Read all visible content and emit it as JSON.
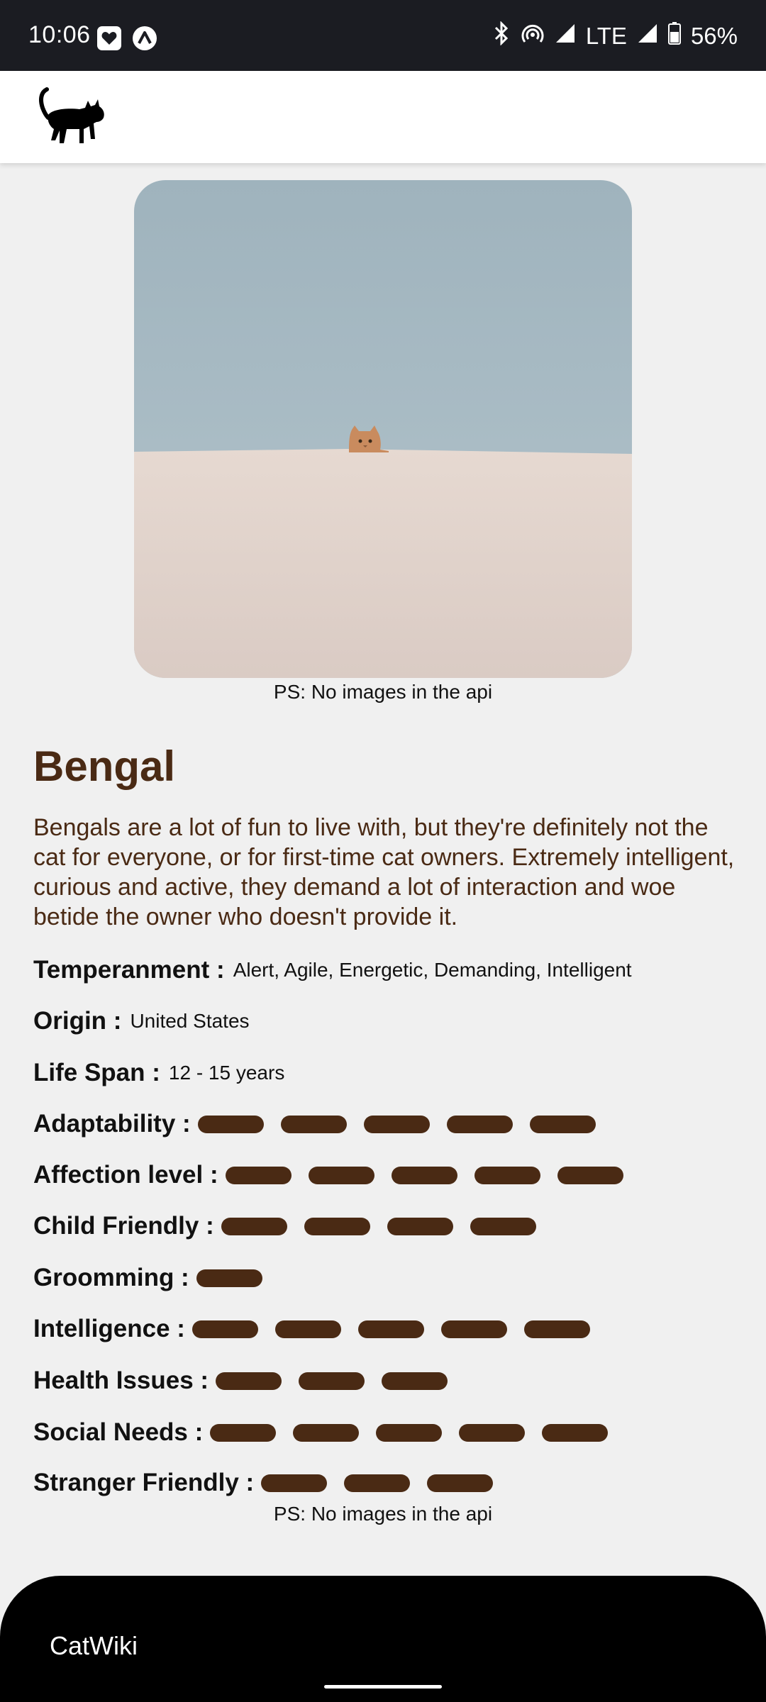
{
  "status_bar": {
    "time": "10:06",
    "network": "LTE",
    "battery": "56%",
    "icons": [
      "heart-notification-icon",
      "arrow-notification-icon",
      "bluetooth-icon",
      "hotspot-icon",
      "signal-icon",
      "battery-icon"
    ]
  },
  "app_bar": {
    "logo": "black-cat-logo"
  },
  "hero": {
    "caption": "PS: No images in the api"
  },
  "breed": {
    "name": "Bengal",
    "description": "Bengals are a lot of fun to live with, but they're definitely not the cat for everyone, or for first-time cat owners. Extremely intelligent, curious and active, they demand a lot of interaction and woe betide the owner who doesn't provide it."
  },
  "info": {
    "temperament_label": "Temperanment :",
    "temperament": "Alert, Agile, Energetic, Demanding, Intelligent",
    "origin_label": "Origin :",
    "origin": "United States",
    "lifespan_label": "Life Span :",
    "lifespan": "12 - 15 years"
  },
  "ratings": [
    {
      "label": "Adaptability :",
      "value": 5
    },
    {
      "label": "Affection level :",
      "value": 5
    },
    {
      "label": "Child Friendly :",
      "value": 4
    },
    {
      "label": "Groomming :",
      "value": 1
    },
    {
      "label": "Intelligence :",
      "value": 5
    },
    {
      "label": "Health Issues :",
      "value": 3
    },
    {
      "label": "Social Needs :",
      "value": 5
    },
    {
      "label": "Stranger Friendly :",
      "value": 3
    }
  ],
  "footer_caption": "PS: No images in the api",
  "bottom_bar": {
    "title": "CatWiki"
  },
  "colors": {
    "accent": "#4a2a14",
    "page_bg": "#f0f0f0",
    "status_bar_bg": "#1b1c22"
  }
}
